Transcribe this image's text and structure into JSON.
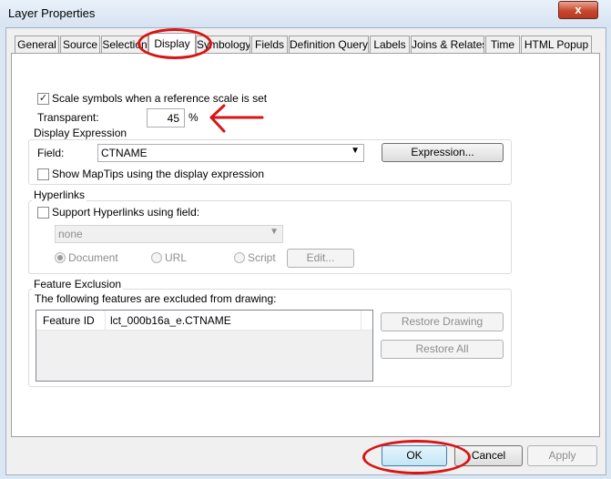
{
  "window": {
    "title": "Layer Properties",
    "close_glyph": "x"
  },
  "tabs": [
    {
      "label": "General"
    },
    {
      "label": "Source"
    },
    {
      "label": "Selection"
    },
    {
      "label": "Display"
    },
    {
      "label": "Symbology"
    },
    {
      "label": "Fields"
    },
    {
      "label": "Definition Query"
    },
    {
      "label": "Labels"
    },
    {
      "label": "Joins & Relates"
    },
    {
      "label": "Time"
    },
    {
      "label": "HTML Popup"
    }
  ],
  "display": {
    "scale_symbols_label": "Scale symbols when a reference scale is set",
    "scale_symbols_checked": true,
    "transparent_label": "Transparent:",
    "transparent_value": "45",
    "transparent_unit": "%"
  },
  "display_expression": {
    "title": "Display Expression",
    "field_label": "Field:",
    "field_value": "CTNAME",
    "expression_button": "Expression...",
    "show_maptips_label": "Show MapTips using the display expression",
    "show_maptips_checked": false
  },
  "hyperlinks": {
    "title": "Hyperlinks",
    "support_label": "Support Hyperlinks using field:",
    "support_checked": false,
    "field_value": "none",
    "radio_document": "Document",
    "radio_url": "URL",
    "radio_script": "Script",
    "selected_radio": "Document",
    "edit_button": "Edit..."
  },
  "feature_exclusion": {
    "title": "Feature Exclusion",
    "description": "The following features are excluded from drawing:",
    "columns": [
      "Feature ID",
      "lct_000b16a_e.CTNAME"
    ],
    "rows": [],
    "restore_drawing_button": "Restore Drawing",
    "restore_all_button": "Restore All"
  },
  "footer": {
    "ok": "OK",
    "cancel": "Cancel",
    "apply": "Apply"
  },
  "annotation_colors": {
    "circle": "#d81414",
    "arrow": "#d81414"
  }
}
